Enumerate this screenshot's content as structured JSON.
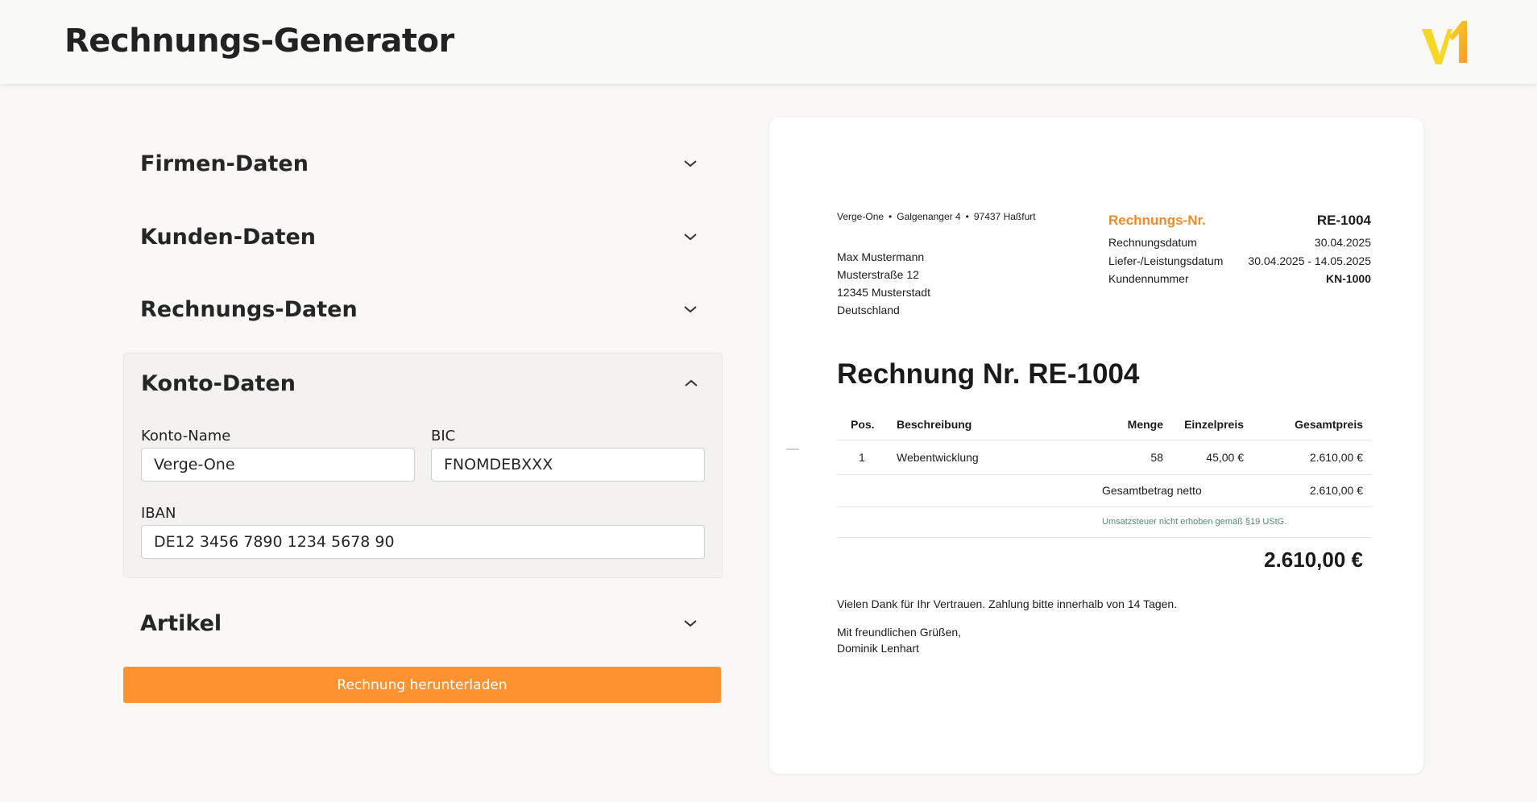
{
  "app": {
    "title": "Rechnungs-Generator",
    "logo_text": "v1"
  },
  "colors": {
    "accent": "#fd9330",
    "logo_yellow": "#f5d726",
    "logo_orange": "#f69a2b"
  },
  "form": {
    "sections": {
      "firmen": {
        "title": "Firmen-Daten",
        "expanded": false
      },
      "kunden": {
        "title": "Kunden-Daten",
        "expanded": false
      },
      "rechnung": {
        "title": "Rechnungs-Daten",
        "expanded": false
      },
      "konto": {
        "title": "Konto-Daten",
        "expanded": true,
        "konto_name_label": "Konto-Name",
        "konto_name_value": "Verge-One",
        "bic_label": "BIC",
        "bic_value": "FNOMDEBXXX",
        "iban_label": "IBAN",
        "iban_value": "DE12 3456 7890 1234 5678 90"
      },
      "artikel": {
        "title": "Artikel",
        "expanded": false
      }
    },
    "download_label": "Rechnung herunterladen"
  },
  "invoice": {
    "sender": {
      "name": "Verge-One",
      "street": "Galgenanger 4",
      "city": "97437 Haßfurt",
      "separator": "•"
    },
    "recipient": {
      "name": "Max Mustermann",
      "street": "Musterstraße 12",
      "city": "12345 Musterstadt",
      "country": "Deutschland"
    },
    "meta": {
      "number_label": "Rechnungs-Nr.",
      "number_value": "RE-1004",
      "date_label": "Rechnungsdatum",
      "date_value": "30.04.2025",
      "period_label": "Liefer-/Leistungsdatum",
      "period_value": "30.04.2025 - 14.05.2025",
      "customer_label": "Kundennummer",
      "customer_value": "KN-1000"
    },
    "title": "Rechnung Nr. RE-1004",
    "table": {
      "headers": {
        "pos": "Pos.",
        "description": "Beschreibung",
        "quantity": "Menge",
        "unit_price": "Einzelpreis",
        "total_price": "Gesamtpreis"
      },
      "rows": [
        {
          "pos": "1",
          "description": "Webentwicklung",
          "quantity": "58",
          "unit_price": "45,00 €",
          "total_price": "2.610,00 €"
        }
      ]
    },
    "net_label": "Gesamtbetrag netto",
    "net_value": "2.610,00 €",
    "tax_note": "Umsatzsteuer nicht erhoben gemäß §19 UStG.",
    "total": "2.610,00 €",
    "thanks": "Vielen Dank für Ihr Vertrauen. Zahlung bitte innerhalb von 14 Tagen.",
    "greeting": "Mit freundlichen Grüßen,",
    "signature": "Dominik Lenhart"
  }
}
